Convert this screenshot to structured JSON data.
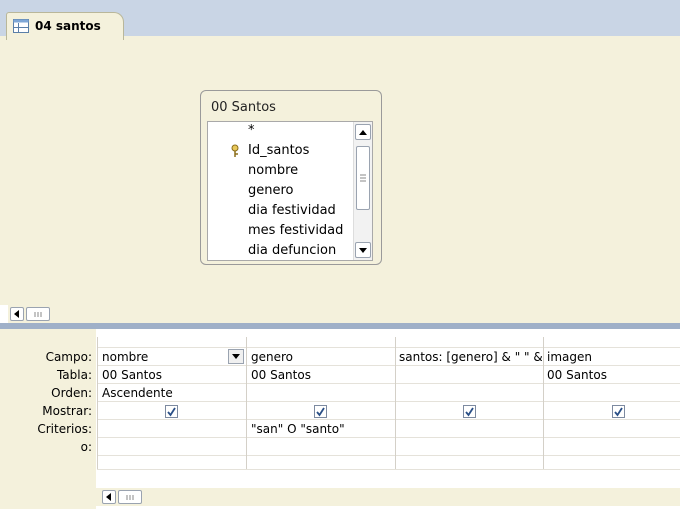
{
  "tab": {
    "label": "04 santos",
    "icon": "query-icon"
  },
  "table_window": {
    "title": "00 Santos",
    "fields": [
      "*",
      "Id_santos",
      "nombre",
      "genero",
      "dia festividad",
      "mes festividad",
      "dia defuncion"
    ]
  },
  "grid": {
    "row_labels": [
      "Campo:",
      "Tabla:",
      "Orden:",
      "Mostrar:",
      "Criterios:",
      "o:"
    ],
    "columns": [
      {
        "campo": "nombre",
        "tabla": "00 Santos",
        "orden": "Ascendente",
        "mostrar": true,
        "criterios": ""
      },
      {
        "campo": "genero",
        "tabla": "00 Santos",
        "orden": "",
        "mostrar": true,
        "criterios": "\"san\" O \"santo\""
      },
      {
        "campo": "santos: [genero] & \" \" &",
        "tabla": "",
        "orden": "",
        "mostrar": true,
        "criterios": ""
      },
      {
        "campo": "imagen",
        "tabla": "00 Santos",
        "orden": "",
        "mostrar": true,
        "criterios": ""
      }
    ]
  },
  "colors": {
    "tab_bg": "#c9d5e5",
    "design_bg": "#f4f1dc",
    "splitter": "#9fb0c8"
  }
}
